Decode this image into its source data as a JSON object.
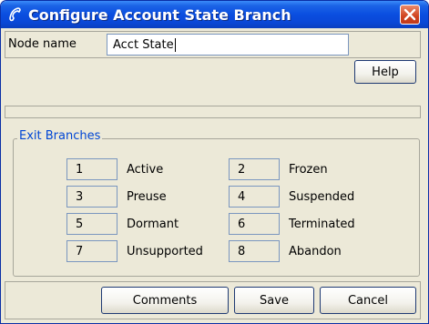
{
  "window": {
    "title": "Configure Account State Branch",
    "title_icon": "phone-handset-icon",
    "close_icon": "close-x-icon"
  },
  "node": {
    "label": "Node name",
    "value": "Acct State",
    "help_label": "Help"
  },
  "exit_branches": {
    "title": "Exit Branches",
    "items": [
      {
        "num": "1",
        "name": "Active"
      },
      {
        "num": "2",
        "name": "Frozen"
      },
      {
        "num": "3",
        "name": "Preuse"
      },
      {
        "num": "4",
        "name": "Suspended"
      },
      {
        "num": "5",
        "name": "Dormant"
      },
      {
        "num": "6",
        "name": "Terminated"
      },
      {
        "num": "7",
        "name": "Unsupported"
      },
      {
        "num": "8",
        "name": "Abandon"
      }
    ]
  },
  "buttons": {
    "comments": "Comments",
    "save": "Save",
    "cancel": "Cancel"
  },
  "colors": {
    "titlebar": "#0a4ee0",
    "group_title": "#0046d5",
    "close": "#d0431f"
  }
}
